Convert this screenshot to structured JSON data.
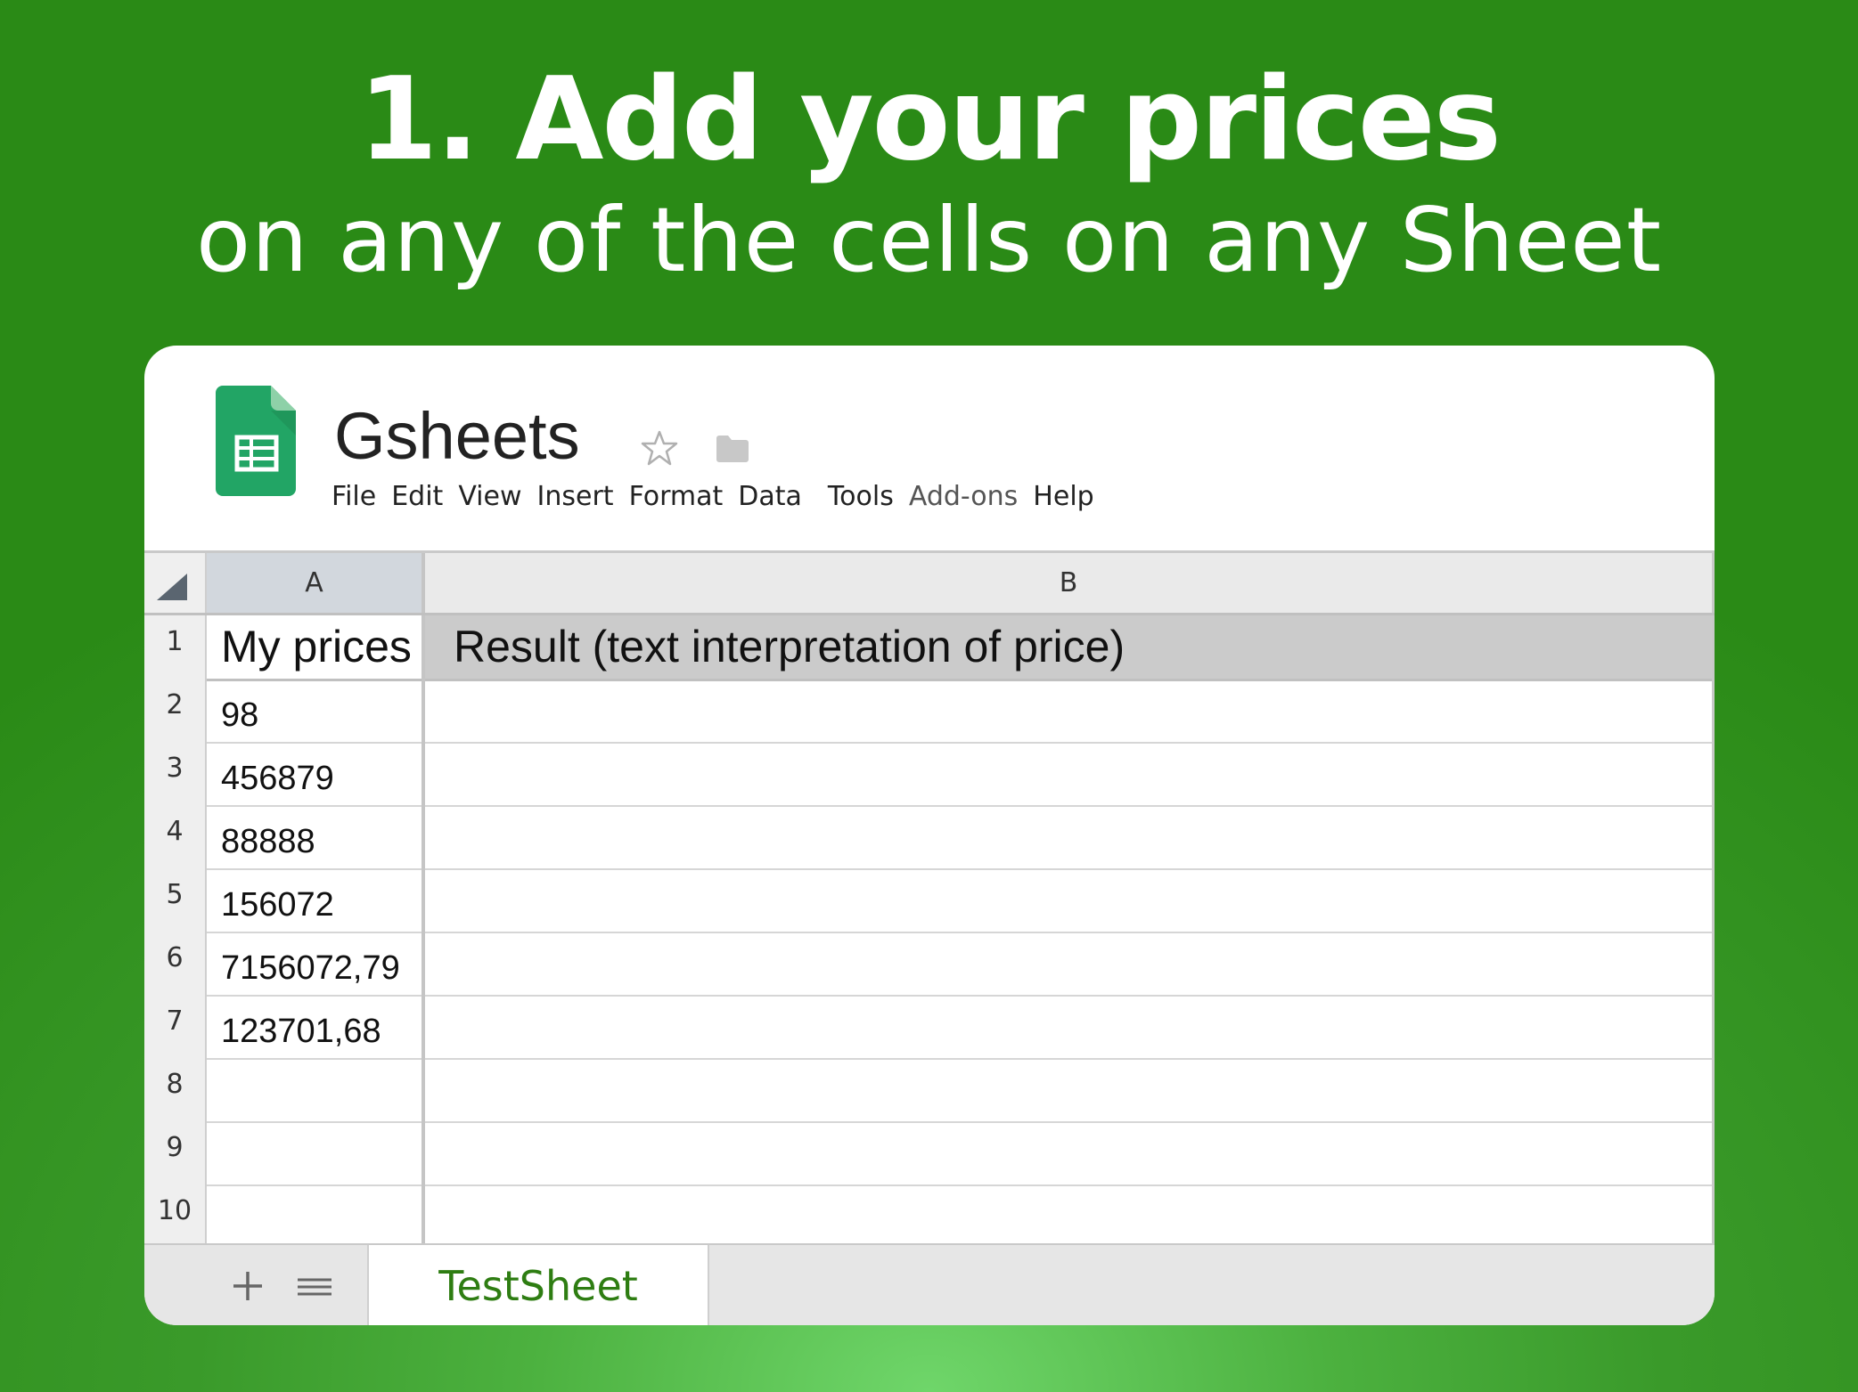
{
  "headline": "1. Add your prices",
  "subheadline": "on any of the cells on any Sheet",
  "app": {
    "title": "Gsheets",
    "menu": [
      "File",
      "Edit",
      "View",
      "Insert",
      "Format",
      "Data",
      "Tools",
      "Add-ons",
      "Help"
    ]
  },
  "columns": [
    "A",
    "B"
  ],
  "rows": [
    {
      "num": "1",
      "a": "My prices",
      "b": "Result (text interpretation of price)"
    },
    {
      "num": "2",
      "a": "98",
      "b": ""
    },
    {
      "num": "3",
      "a": "456879",
      "b": ""
    },
    {
      "num": "4",
      "a": "88888",
      "b": ""
    },
    {
      "num": "5",
      "a": "156072",
      "b": ""
    },
    {
      "num": "6",
      "a": "7156072,79",
      "b": ""
    },
    {
      "num": "7",
      "a": "123701,68",
      "b": ""
    },
    {
      "num": "8",
      "a": "",
      "b": ""
    },
    {
      "num": "9",
      "a": "",
      "b": ""
    },
    {
      "num": "10",
      "a": "",
      "b": ""
    }
  ],
  "sheet_tab": "TestSheet",
  "icons": {
    "logo": "google-sheets-logo-icon",
    "star": "star-outline-icon",
    "folder": "folder-icon",
    "add": "plus-icon",
    "list": "menu-lines-icon"
  },
  "colors": {
    "background": "#3a9a2a",
    "sheets_green": "#22a565",
    "tab_text": "#2e7d12",
    "selected_column_header": "#d2d7dd",
    "header_row_fill": "#cbcbcb"
  }
}
